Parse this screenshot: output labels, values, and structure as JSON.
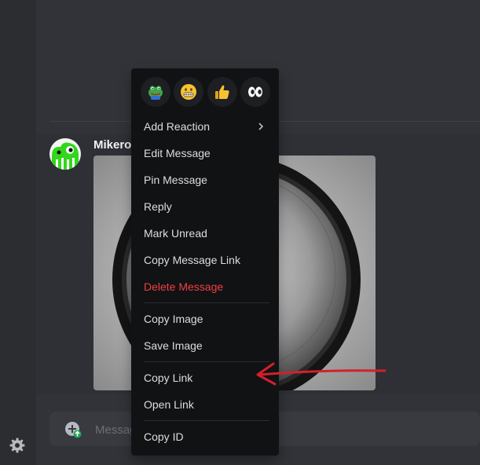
{
  "message": {
    "author": "Mikero"
  },
  "composer": {
    "placeholder": "Message"
  },
  "context_menu": {
    "reactions": [
      {
        "icon": "frog-emoji-icon"
      },
      {
        "icon": "grimace-emoji-icon"
      },
      {
        "icon": "thumbs-up-emoji-icon"
      },
      {
        "icon": "eyes-emoji-icon"
      }
    ],
    "items": {
      "add_reaction": "Add Reaction",
      "edit_message": "Edit Message",
      "pin_message": "Pin Message",
      "reply": "Reply",
      "mark_unread": "Mark Unread",
      "copy_message_link": "Copy Message Link",
      "delete_message": "Delete Message",
      "copy_image": "Copy Image",
      "save_image": "Save Image",
      "copy_link": "Copy Link",
      "open_link": "Open Link",
      "copy_id": "Copy ID"
    }
  },
  "colors": {
    "background": "#313338",
    "menu_background": "#111214",
    "danger": "#f23f42",
    "annotation_arrow": "#d3202c"
  }
}
